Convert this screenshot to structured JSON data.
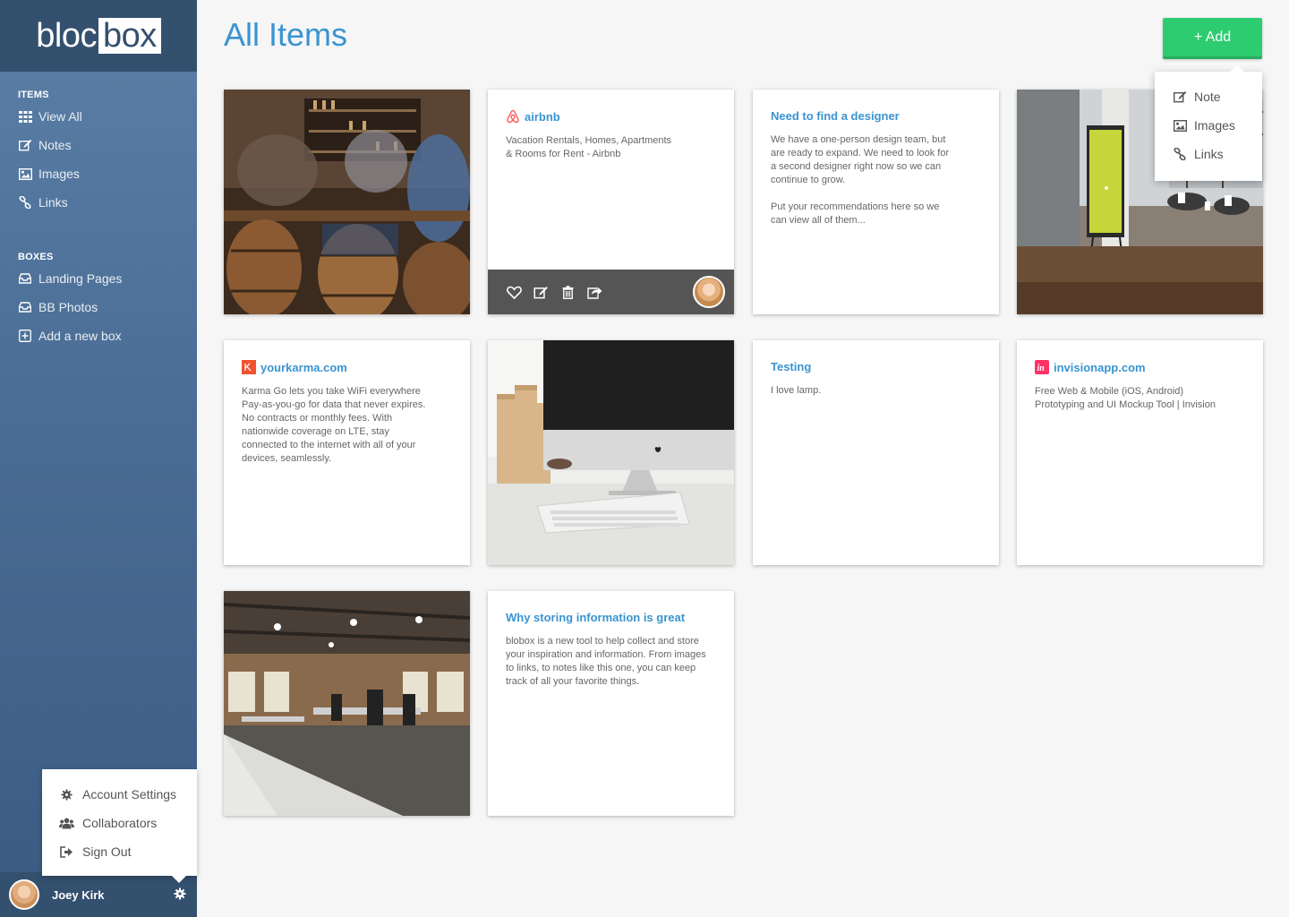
{
  "app": {
    "logo_left": "bloc",
    "logo_right": "box"
  },
  "sidebar": {
    "items_heading": "ITEMS",
    "items": [
      {
        "label": "View All",
        "icon": "grid-icon"
      },
      {
        "label": "Notes",
        "icon": "edit-icon"
      },
      {
        "label": "Images",
        "icon": "image-icon"
      },
      {
        "label": "Links",
        "icon": "link-icon"
      }
    ],
    "boxes_heading": "BOXES",
    "boxes": [
      {
        "label": "Landing Pages",
        "icon": "inbox-icon"
      },
      {
        "label": "BB Photos",
        "icon": "inbox-icon"
      },
      {
        "label": "Add a new box",
        "icon": "plus-square-icon"
      }
    ]
  },
  "account_menu": {
    "items": [
      {
        "label": "Account Settings",
        "icon": "gear-icon"
      },
      {
        "label": "Collaborators",
        "icon": "users-icon"
      },
      {
        "label": "Sign Out",
        "icon": "sign-out-icon"
      }
    ]
  },
  "user": {
    "name": "Joey Kirk"
  },
  "main": {
    "title": "All Items",
    "add_button": "+ Add",
    "add_menu": [
      {
        "label": "Note",
        "icon": "edit-icon"
      },
      {
        "label": "Images",
        "icon": "image-icon"
      },
      {
        "label": "Links",
        "icon": "link-icon"
      }
    ]
  },
  "cards": {
    "airbnb": {
      "title": "airbnb",
      "body": "Vacation Rentals, Homes, Apartments\n& Rooms for Rent - Airbnb"
    },
    "designer": {
      "title": "Need to find a designer",
      "body": "We have a one-person design team, but\nare ready to expand. We need to look for\na second designer right now so we can\ncontinue to grow.\n\nPut your recommendations here so we\ncan view all of them..."
    },
    "yourkarma": {
      "title": "yourkarma.com",
      "body": "Karma Go lets you take WiFi everywhere\nPay-as-you-go for data that never expires.\nNo contracts or monthly fees. With\nnationwide coverage on LTE, stay\nconnected to the internet with all of your\ndevices, seamlessly."
    },
    "testing": {
      "title": "Testing",
      "body": "I love lamp."
    },
    "invision": {
      "title": "invisionapp.com",
      "body": "Free Web & Mobile (iOS, Android)\nPrototyping and UI Mockup Tool | Invision"
    },
    "storing": {
      "title": "Why storing information is great",
      "body": "blobox is a new tool to help collect and store\nyour inspiration and information. From images\nto links, to notes like this one,  you can keep\ntrack of all your favorite things."
    }
  },
  "colors": {
    "accent": "#3a94d0",
    "add_green": "#2ecc71",
    "sidebar": "#4a6d95",
    "sidebar_dark": "#34506f",
    "airbnb": "#ff5a5f",
    "karma": "#f0522e",
    "invision": "#ff3366"
  }
}
